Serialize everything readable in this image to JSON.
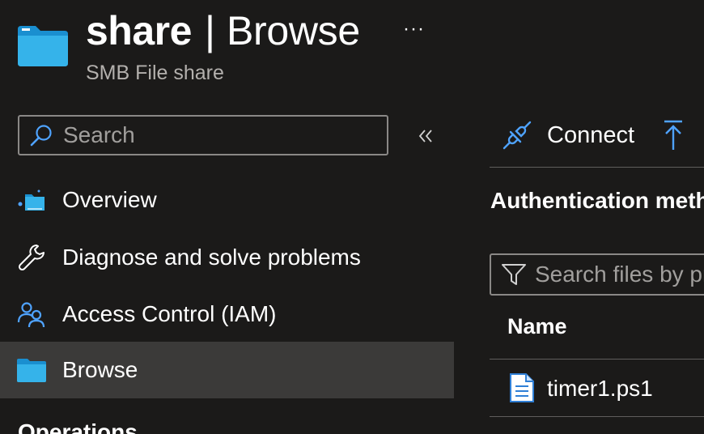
{
  "header": {
    "title": "share",
    "separator": "|",
    "section": "Browse",
    "subtitle": "SMB File share",
    "more": "···"
  },
  "sidebar": {
    "search_placeholder": "Search",
    "collapse_glyph": "«",
    "items": [
      {
        "label": "Overview",
        "icon": "overview-icon",
        "selected": false
      },
      {
        "label": "Diagnose and solve problems",
        "icon": "wrench-icon",
        "selected": false
      },
      {
        "label": "Access Control (IAM)",
        "icon": "people-icon",
        "selected": false
      },
      {
        "label": "Browse",
        "icon": "folder-icon",
        "selected": true
      }
    ],
    "next_partial": "Operations"
  },
  "toolbar": {
    "connect_label": "Connect",
    "upload_icon": "upload-icon"
  },
  "content": {
    "auth_label": "Authentication meth",
    "file_search_placeholder": "Search files by pr",
    "column_name": "Name",
    "files": [
      {
        "name": "timer1.ps1",
        "icon": "document-icon"
      }
    ]
  },
  "colors": {
    "background": "#1b1a19",
    "selected": "#3b3a39",
    "accent": "#4fa3ff",
    "folder": "#2ea7e0"
  }
}
